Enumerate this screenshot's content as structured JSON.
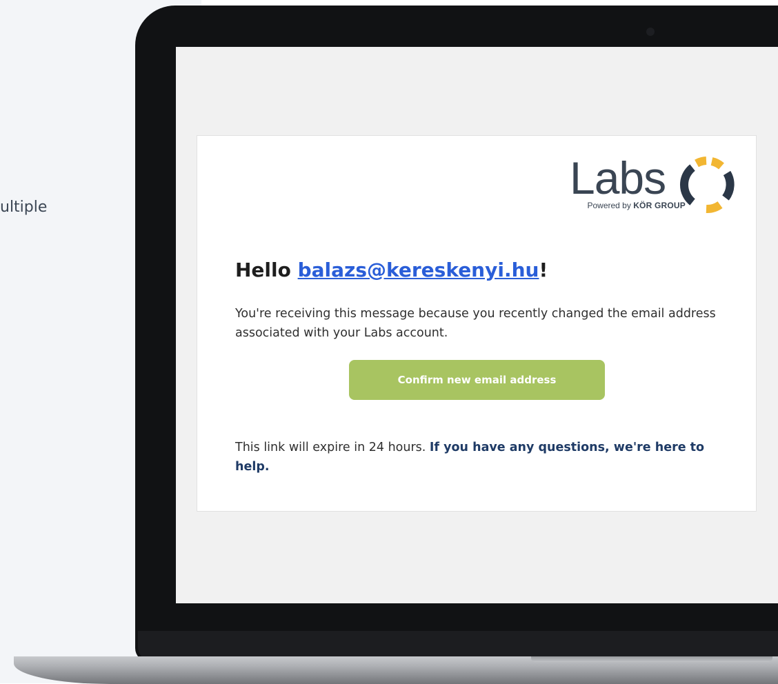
{
  "background": {
    "fragment_text": "ultiple"
  },
  "email": {
    "logo": {
      "word": "Labs",
      "powered_prefix": "Powered by ",
      "powered_brand": "KÖR GROUP",
      "colors": {
        "text": "#3a4553",
        "ring_yellow": "#f2b632",
        "ring_dark": "#2b3747"
      }
    },
    "greeting_prefix": "Hello ",
    "greeting_email": "balazs@kereskenyi.hu",
    "greeting_suffix": "!",
    "body_text": "You're receiving this message because you recently changed the email address associated with your Labs account.",
    "confirm_button_label": "Confirm new email address",
    "expire_text": "This link will expire in 24 hours. ",
    "help_link_text": "If you have any questions, we're here to help.",
    "colors": {
      "button": "#a8c461",
      "link": "#2a5ed8",
      "help_link": "#1f3b66"
    }
  }
}
